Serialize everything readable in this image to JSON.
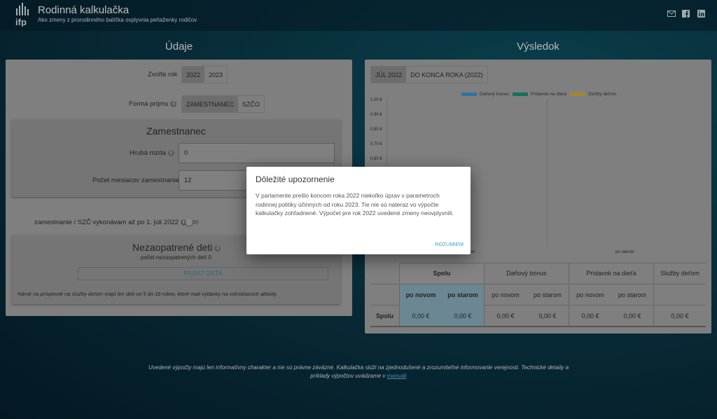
{
  "header": {
    "logo_text": "ifp",
    "title": "Rodinná kalkulačka",
    "subtitle": "Ako zmeny z prorodinného balíčka ovplyvnia peňaženky rodičov",
    "icons": [
      "mail-icon",
      "facebook-icon",
      "linkedin-icon"
    ]
  },
  "left": {
    "title": "Údaje",
    "year_label": "Zvoľte rok",
    "years": [
      "2022",
      "2023"
    ],
    "income_label": "Forma príjmu",
    "income_options": [
      "ZAMESTNANEC",
      "SZČO"
    ],
    "employee": {
      "title": "Zamestnanec",
      "gross_label": "Hrubá mzda",
      "gross_value": "0",
      "months_label": "Počet mesiacov zamestnania",
      "months_value": "12"
    },
    "toggle_label": "zamestnanie / SZČ vykonávam až po 1. júli 2022",
    "children": {
      "title": "Nezaopatrené deti",
      "count": "počet nezaopatrených detí 0",
      "add_button": "PRIDAŤ DIEŤA",
      "note": "Nárok na príspevok na služby deťom majú len deti od 5 do 18 rokov, ktoré mali výdavky na voľnočasové aktivity."
    }
  },
  "right": {
    "title": "Výsledok",
    "tabs": [
      "JÚL 2022",
      "DO KONCA ROKA (2022)"
    ],
    "legend": [
      {
        "label": "Daňový bonus",
        "color": "#3d8dc2"
      },
      {
        "label": "Prídavok na dieťa",
        "color": "#1f8a6e"
      },
      {
        "label": "Služby deťom",
        "color": "#c9a43b"
      }
    ],
    "y_ticks": [
      "1,00 €",
      "0,90 €",
      "0,80 €",
      "0,70 €",
      "0,60 €"
    ],
    "x_labels": [
      "po novom",
      "po starom"
    ],
    "table": {
      "groups": [
        "Spolu",
        "Daňový bonus",
        "Prídavok na dieťa",
        "Služby deťom"
      ],
      "sub": [
        "po novom",
        "po starom"
      ],
      "row_label": "Spolu",
      "values": [
        "0,00 €",
        "0,00 €",
        "0,00 €",
        "0,00 €",
        "0,00 €",
        "0,00 €",
        "0,00 €"
      ]
    }
  },
  "modal": {
    "title": "Dôležité upozornenie",
    "body": "V parlamente prešlo koncom roka 2022 niekoľko úprav v parametroch rodinnej politiky účinných od roku 2023. Tie nie sú nateraz vo výpočte kalkulačky zohľadnené. Výpočet pre rok 2022 uvedené zmeny neovplyvnili.",
    "button": "ROZUMIEM"
  },
  "footer": {
    "text": "Uvedené výpočty majú len informatívny charakter a nie sú právne záväzné. Kalkulačka slúži na zjednodušené a zrozumiteľné informovanie verejnosti. Technické detaily a príklady výpočtov uvádzame v",
    "link": "manuáli"
  }
}
